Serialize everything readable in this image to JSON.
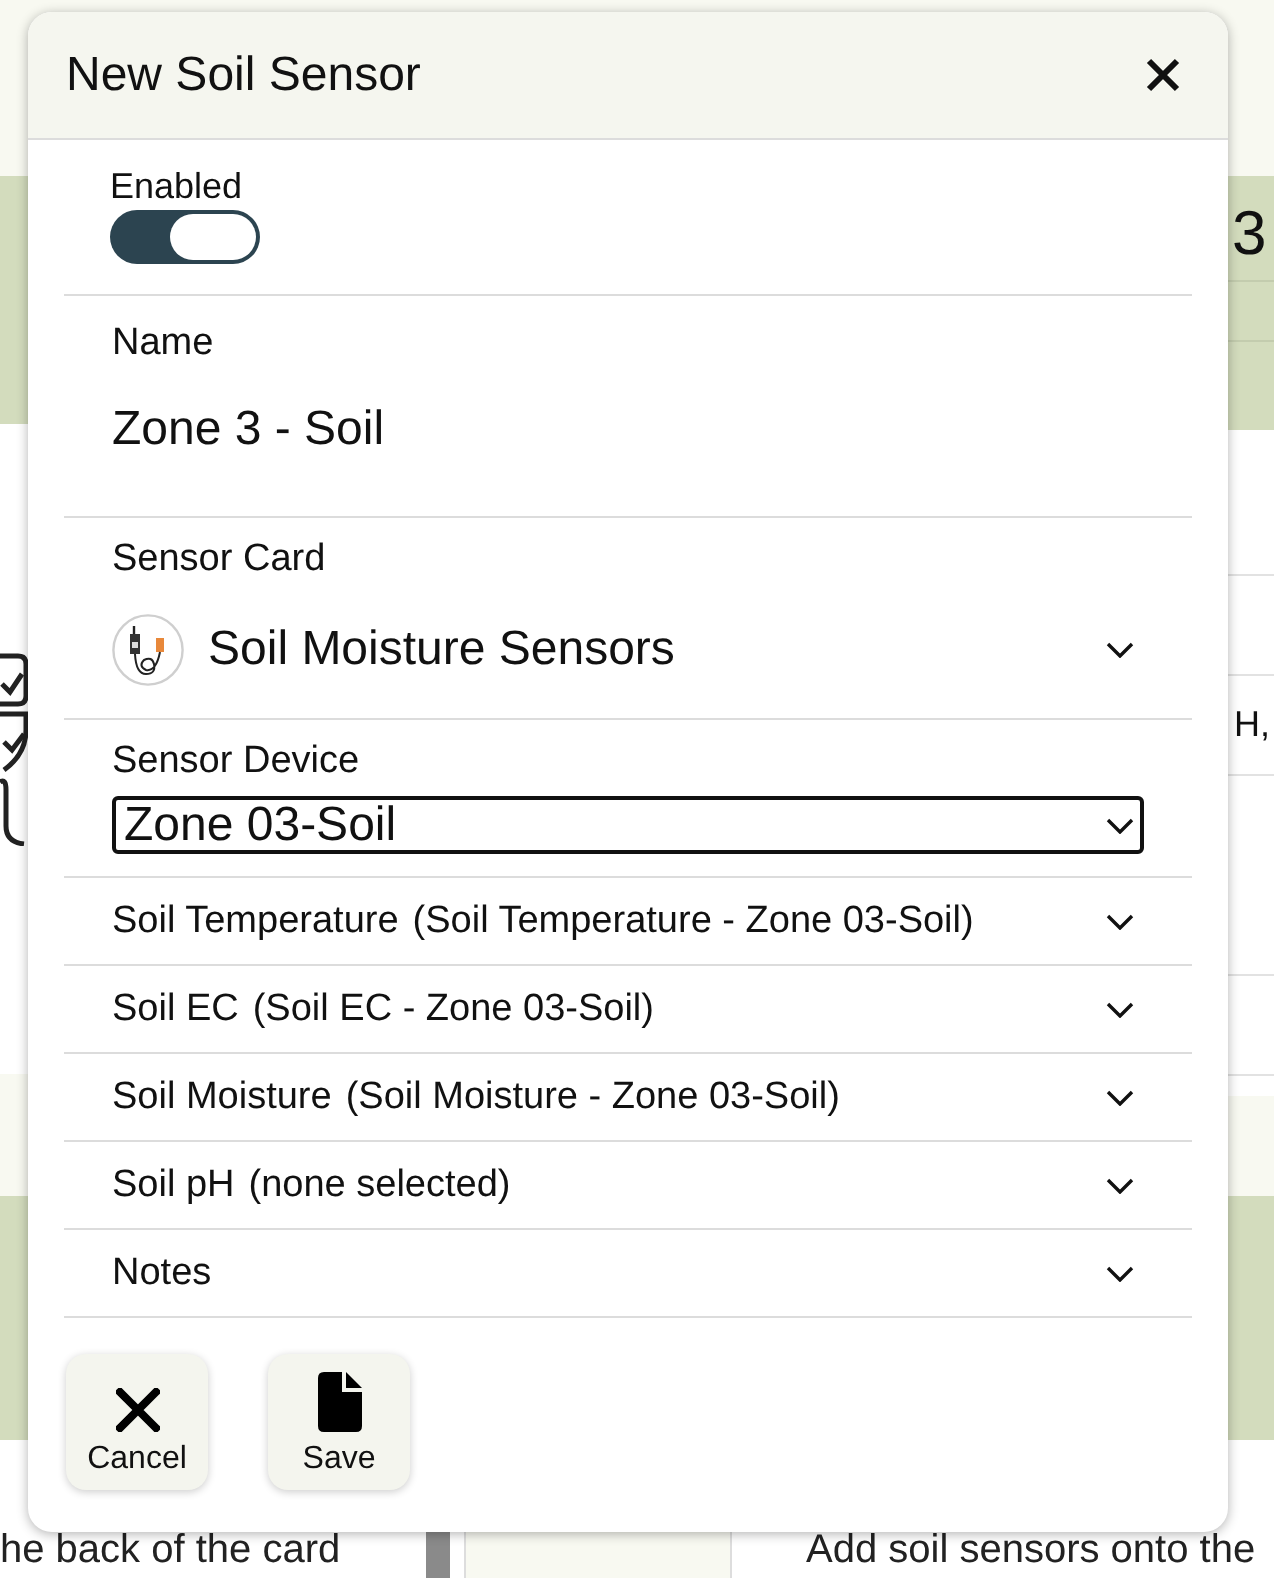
{
  "background": {
    "right_card": {
      "title": "3",
      "text": "H,"
    },
    "bottom_row": {
      "left_text": "he back of the card",
      "right_text": "Add soil sensors onto the"
    }
  },
  "dialog": {
    "title": "New Soil Sensor",
    "enabled": {
      "label": "Enabled",
      "on": true
    },
    "name": {
      "label": "Name",
      "value": "Zone 3 - Soil"
    },
    "sensor_card": {
      "label": "Sensor Card",
      "value": "Soil Moisture Sensors"
    },
    "sensor_device": {
      "label": "Sensor Device",
      "value": "Zone 03-Soil"
    },
    "sections": [
      {
        "title": "Soil Temperature",
        "detail": "(Soil Temperature - Zone 03-Soil)",
        "expanded": false
      },
      {
        "title": "Soil EC",
        "detail": "(Soil EC - Zone 03-Soil)",
        "expanded": false
      },
      {
        "title": "Soil Moisture",
        "detail": "(Soil Moisture - Zone 03-Soil)",
        "expanded": false
      },
      {
        "title": "Soil pH",
        "detail": "(none selected)",
        "expanded": false
      },
      {
        "title": "Notes",
        "expanded": false
      }
    ],
    "buttons": [
      {
        "kind": "cancel",
        "label": "Cancel"
      },
      {
        "kind": "save",
        "label": "Save"
      }
    ]
  }
}
